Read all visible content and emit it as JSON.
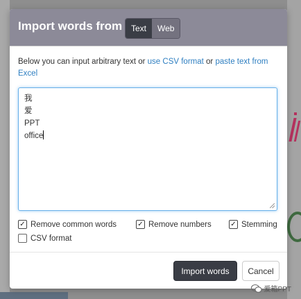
{
  "modal": {
    "title": "Import words from",
    "tabs": [
      {
        "label": "Text",
        "active": true
      },
      {
        "label": "Web",
        "active": false
      }
    ],
    "intro": {
      "text_before": "Below you can input arbitrary text or ",
      "link_csv": "use CSV format",
      "text_middle": " or ",
      "link_paste": "paste text from Excel"
    },
    "textarea": {
      "lines": [
        "我",
        "爱",
        "PPT",
        "office"
      ]
    },
    "options": [
      {
        "label": "Remove common words",
        "checked": true
      },
      {
        "label": "Remove numbers",
        "checked": true
      },
      {
        "label": "Stemming",
        "checked": true
      },
      {
        "label": "CSV format",
        "checked": false
      }
    ],
    "buttons": {
      "import_label": "Import words",
      "cancel_label": "Cancel"
    }
  },
  "watermark": {
    "text": "爱箱PPT",
    "icon": "wechat-icon"
  },
  "colors": {
    "header": "#8c8a98",
    "tab_active": "#3a3d45",
    "link": "#2f7fc1",
    "focus": "#66afe9",
    "primary_button": "#3a3d45"
  }
}
